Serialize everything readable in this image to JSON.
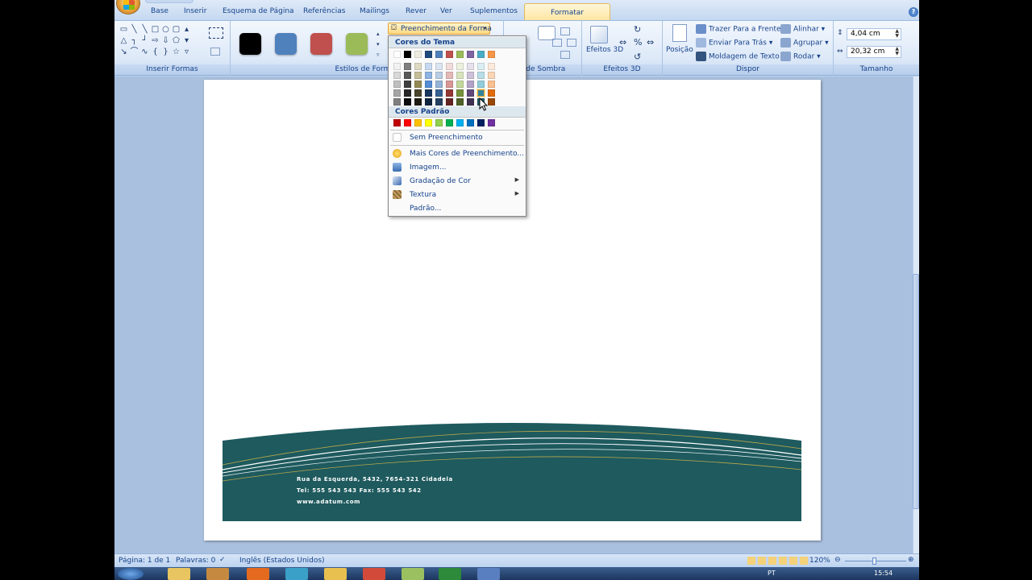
{
  "tabs": [
    "Base",
    "Inserir",
    "Esquema de Página",
    "Referências",
    "Mailings",
    "Rever",
    "Ver",
    "Suplementos"
  ],
  "active_tab": "Formatar",
  "ribbon": {
    "group_insert_shapes": "Inserir Formas",
    "group_shape_styles": "Estilos de Formas",
    "group_shadow": "s de Sombra",
    "group_3d": "Efeitos 3D",
    "group_arrange": "Dispor",
    "group_size": "Tamanho",
    "fill_button": "Preenchimento da Forma",
    "effects_3d_button": "Efeitos 3D",
    "position_button": "Posição",
    "bring_front": "Trazer Para a Frente",
    "send_back": "Enviar Para Trás",
    "text_wrap": "Moldagem de Texto",
    "align": "Alinhar",
    "group": "Agrupar",
    "rotate": "Rodar",
    "height_value": "4,04 cm",
    "width_value": "20,32 cm"
  },
  "style_swatches": [
    "#000000",
    "#4f81bd",
    "#c0504d",
    "#9bbb59"
  ],
  "dropdown": {
    "theme_colors_header": "Cores do Tema",
    "standard_colors_header": "Cores Padrão",
    "theme_rows": [
      [
        "#ffffff",
        "#000000",
        "#eeece1",
        "#1f497d",
        "#4f81bd",
        "#c0504d",
        "#9bbb59",
        "#8064a2",
        "#4bacc6",
        "#f79646"
      ],
      [
        "#f2f2f2",
        "#7f7f7f",
        "#ddd9c3",
        "#c6d9f0",
        "#dbe5f1",
        "#f2dcdb",
        "#ebf1dd",
        "#e5e0ec",
        "#dbeef3",
        "#fdeada"
      ],
      [
        "#d8d8d8",
        "#595959",
        "#c4bd97",
        "#8db3e2",
        "#b8cce4",
        "#e5b9b7",
        "#d7e3bc",
        "#ccc1d9",
        "#b7dde8",
        "#fbd5b5"
      ],
      [
        "#bfbfbf",
        "#3f3f3f",
        "#938953",
        "#548dd4",
        "#95b3d7",
        "#d99694",
        "#c3d69b",
        "#b2a2c7",
        "#92cddc",
        "#fac08f"
      ],
      [
        "#a5a5a5",
        "#262626",
        "#494429",
        "#17365d",
        "#366092",
        "#953734",
        "#76923c",
        "#5f497a",
        "#31859b",
        "#e36c09"
      ],
      [
        "#7f7f7f",
        "#0c0c0c",
        "#1d1b10",
        "#0f243e",
        "#244061",
        "#632423",
        "#4f6128",
        "#3f3151",
        "#205867",
        "#974806"
      ]
    ],
    "standard_colors": [
      "#c00000",
      "#ff0000",
      "#ffc000",
      "#ffff00",
      "#92d050",
      "#00b050",
      "#00b0f0",
      "#0070c0",
      "#002060",
      "#7030a0"
    ],
    "items": [
      {
        "label": "Sem Preenchimento",
        "icon": "no-fill-icon"
      },
      {
        "label": "Mais Cores de Preenchimento...",
        "icon": "palette-icon"
      },
      {
        "label": "Imagem...",
        "icon": "picture-icon"
      },
      {
        "label": "Gradação de Cor",
        "icon": "gradient-icon",
        "submenu": true
      },
      {
        "label": "Textura",
        "icon": "texture-icon",
        "submenu": true
      },
      {
        "label": "Padrão...",
        "icon": "",
        "submenu": false
      }
    ],
    "hover_cell": "#31859b"
  },
  "document": {
    "band_color": "#1e5a5e",
    "address_line1": "Rua da Esquerda, 5432, 7654-321 Cidadela",
    "address_line2": "Tel: 555 543 543   Fax: 555 543 542",
    "address_line3": "www.adatum.com"
  },
  "status": {
    "page": "Página: 1 de 1",
    "words": "Palavras: 0",
    "language": "Inglês (Estados Unidos)",
    "zoom": "120%"
  },
  "taskbar": {
    "lang": "PT",
    "clock": "15:54"
  }
}
